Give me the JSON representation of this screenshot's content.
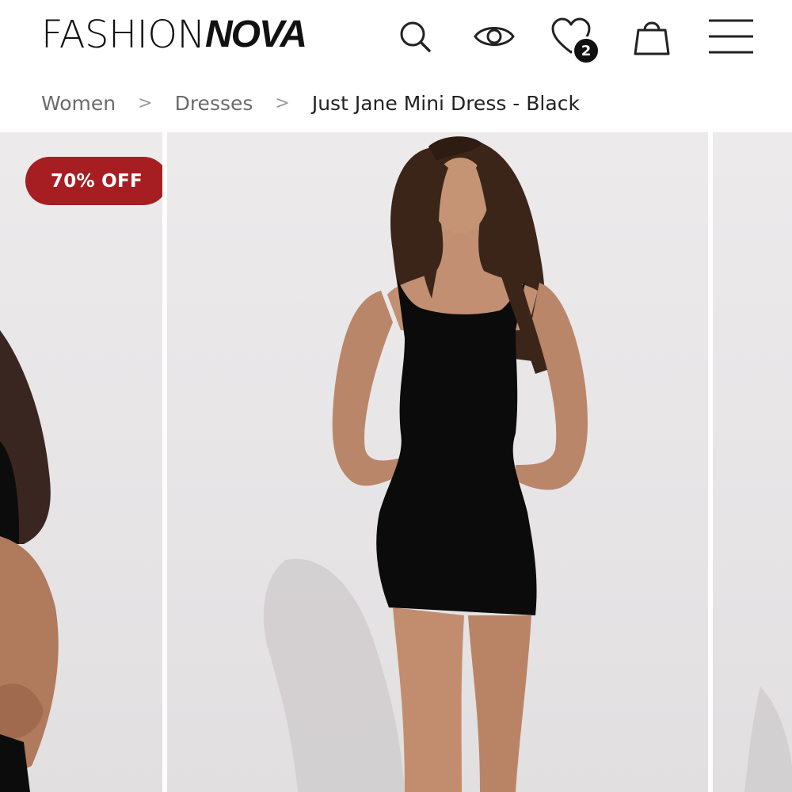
{
  "header": {
    "logo_light": "FASHION",
    "logo_bold": "NOVA",
    "icons": [
      "search-icon",
      "eye-icon",
      "heart-icon",
      "shopping-bag-icon",
      "menu-icon"
    ],
    "wishlist_count": "2"
  },
  "breadcrumb": {
    "items": [
      "Women",
      "Dresses",
      "Just Jane Mini Dress - Black"
    ],
    "separator": ">"
  },
  "gallery": {
    "badge": "70% OFF",
    "badge_color": "#a61e22",
    "background_color": "#e8e6e7"
  }
}
